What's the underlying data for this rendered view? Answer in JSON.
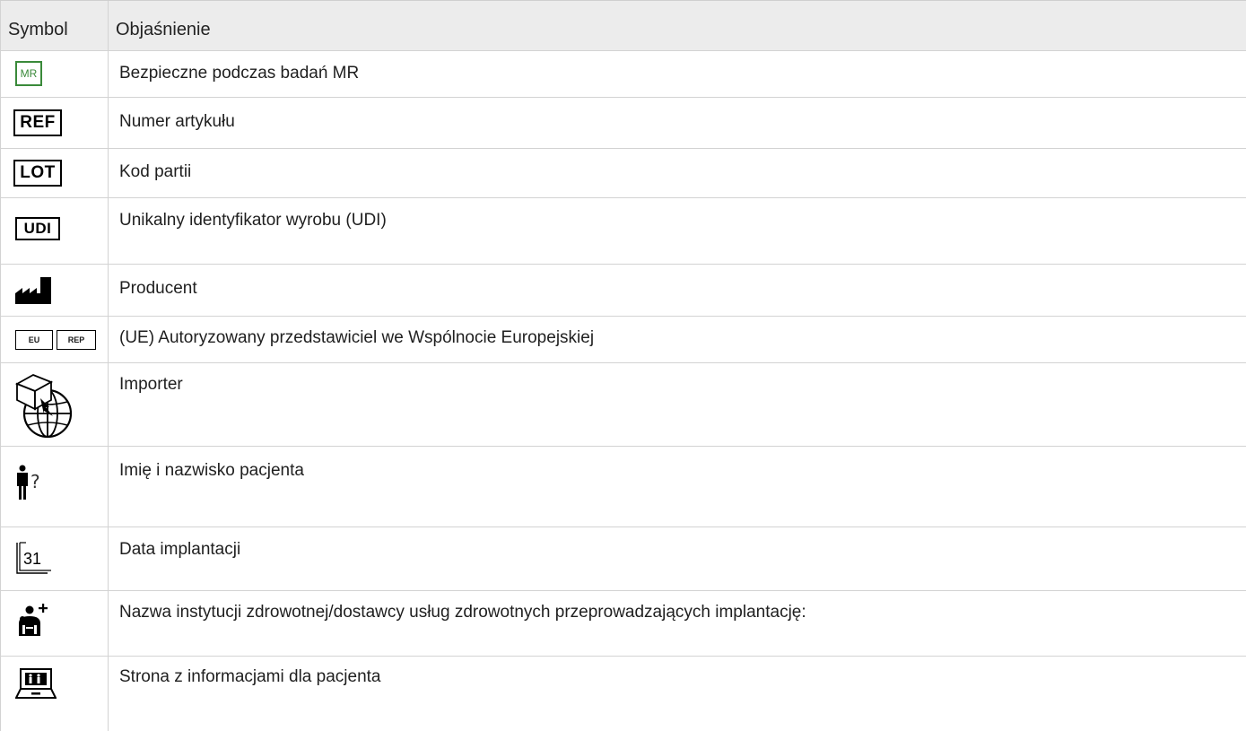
{
  "header": {
    "symbol": "Symbol",
    "explanation": "Objaśnienie"
  },
  "rows": [
    {
      "icon": "mr-safe-icon",
      "badge": "MR",
      "text": "Bezpieczne podczas badań MR"
    },
    {
      "icon": "ref-icon",
      "badge": "REF",
      "text": "Numer artykułu"
    },
    {
      "icon": "lot-icon",
      "badge": "LOT",
      "text": "Kod partii"
    },
    {
      "icon": "udi-icon",
      "badge": "UDI",
      "text": "Unikalny identyfikator wyrobu (UDI)"
    },
    {
      "icon": "manufacturer-icon",
      "text": "Producent"
    },
    {
      "icon": "eu-rep-icon",
      "badge_left": "EU",
      "badge_right": "REP",
      "text": "(UE) Autoryzowany przedstawiciel we Wspólnocie Europejskiej"
    },
    {
      "icon": "importer-icon",
      "text": "Importer"
    },
    {
      "icon": "patient-name-icon",
      "text": "Imię i nazwisko pacjenta"
    },
    {
      "icon": "implant-date-icon",
      "badge": "31",
      "text": "Data implantacji"
    },
    {
      "icon": "health-institution-icon",
      "text": "Nazwa instytucji zdrowotnej/dostawcy usług zdrowotnych przeprowadzających implantację:"
    },
    {
      "icon": "patient-info-website-icon",
      "text": "Strona z informacjami dla pacjenta"
    }
  ],
  "colors": {
    "mr_green": "#3a8a3a",
    "border": "#d3d3d3",
    "header_bg": "#ececec"
  }
}
